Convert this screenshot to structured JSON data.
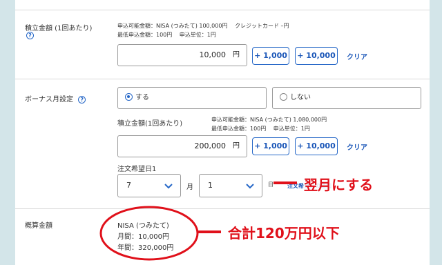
{
  "tsumitate": {
    "label": "積立金額 (1回あたり)",
    "help_icon": "?",
    "info_line1": "申込可能金額：NISA (つみたて) 100,000円　 クレジットカード –円",
    "info_line2": "最低申込金額：100円　 申込単位：1円",
    "amount_value": "10,000",
    "unit": "円",
    "add_1000": "+ 1,000",
    "add_10000": "+ 10,000",
    "clear": "クリア"
  },
  "bonus": {
    "label": "ボーナス月設定",
    "help_icon": "?",
    "option_yes": "する",
    "option_no": "しない",
    "selected": "yes",
    "amount_label": "積立金額(1回あたり)",
    "info_line1": "申込可能金額：NISA (つみたて) 1,080,000円",
    "info_line2": "最低申込金額：100円　 申込単位：1円",
    "amount_value": "200,000",
    "unit": "円",
    "add_1000": "+ 1,000",
    "add_10000": "+ 10,000",
    "clear": "クリア",
    "order_date_label": "注文希望日1",
    "month_value": "7",
    "month_unit": "月",
    "day_value": "1",
    "day_unit_partial": "日",
    "add_order_date_link": "注文希望日の追加"
  },
  "estimate": {
    "label": "概算金額",
    "account": "NISA (つみたて)",
    "monthly": "月間：10,000円",
    "yearly": "年間：320,000円"
  },
  "annotations": {
    "next_month": "翌月にする",
    "total": "合計120万円以下",
    "color": "#e0101a"
  },
  "colors": {
    "background": "#d3e5e9",
    "accent": "#2466c7"
  }
}
